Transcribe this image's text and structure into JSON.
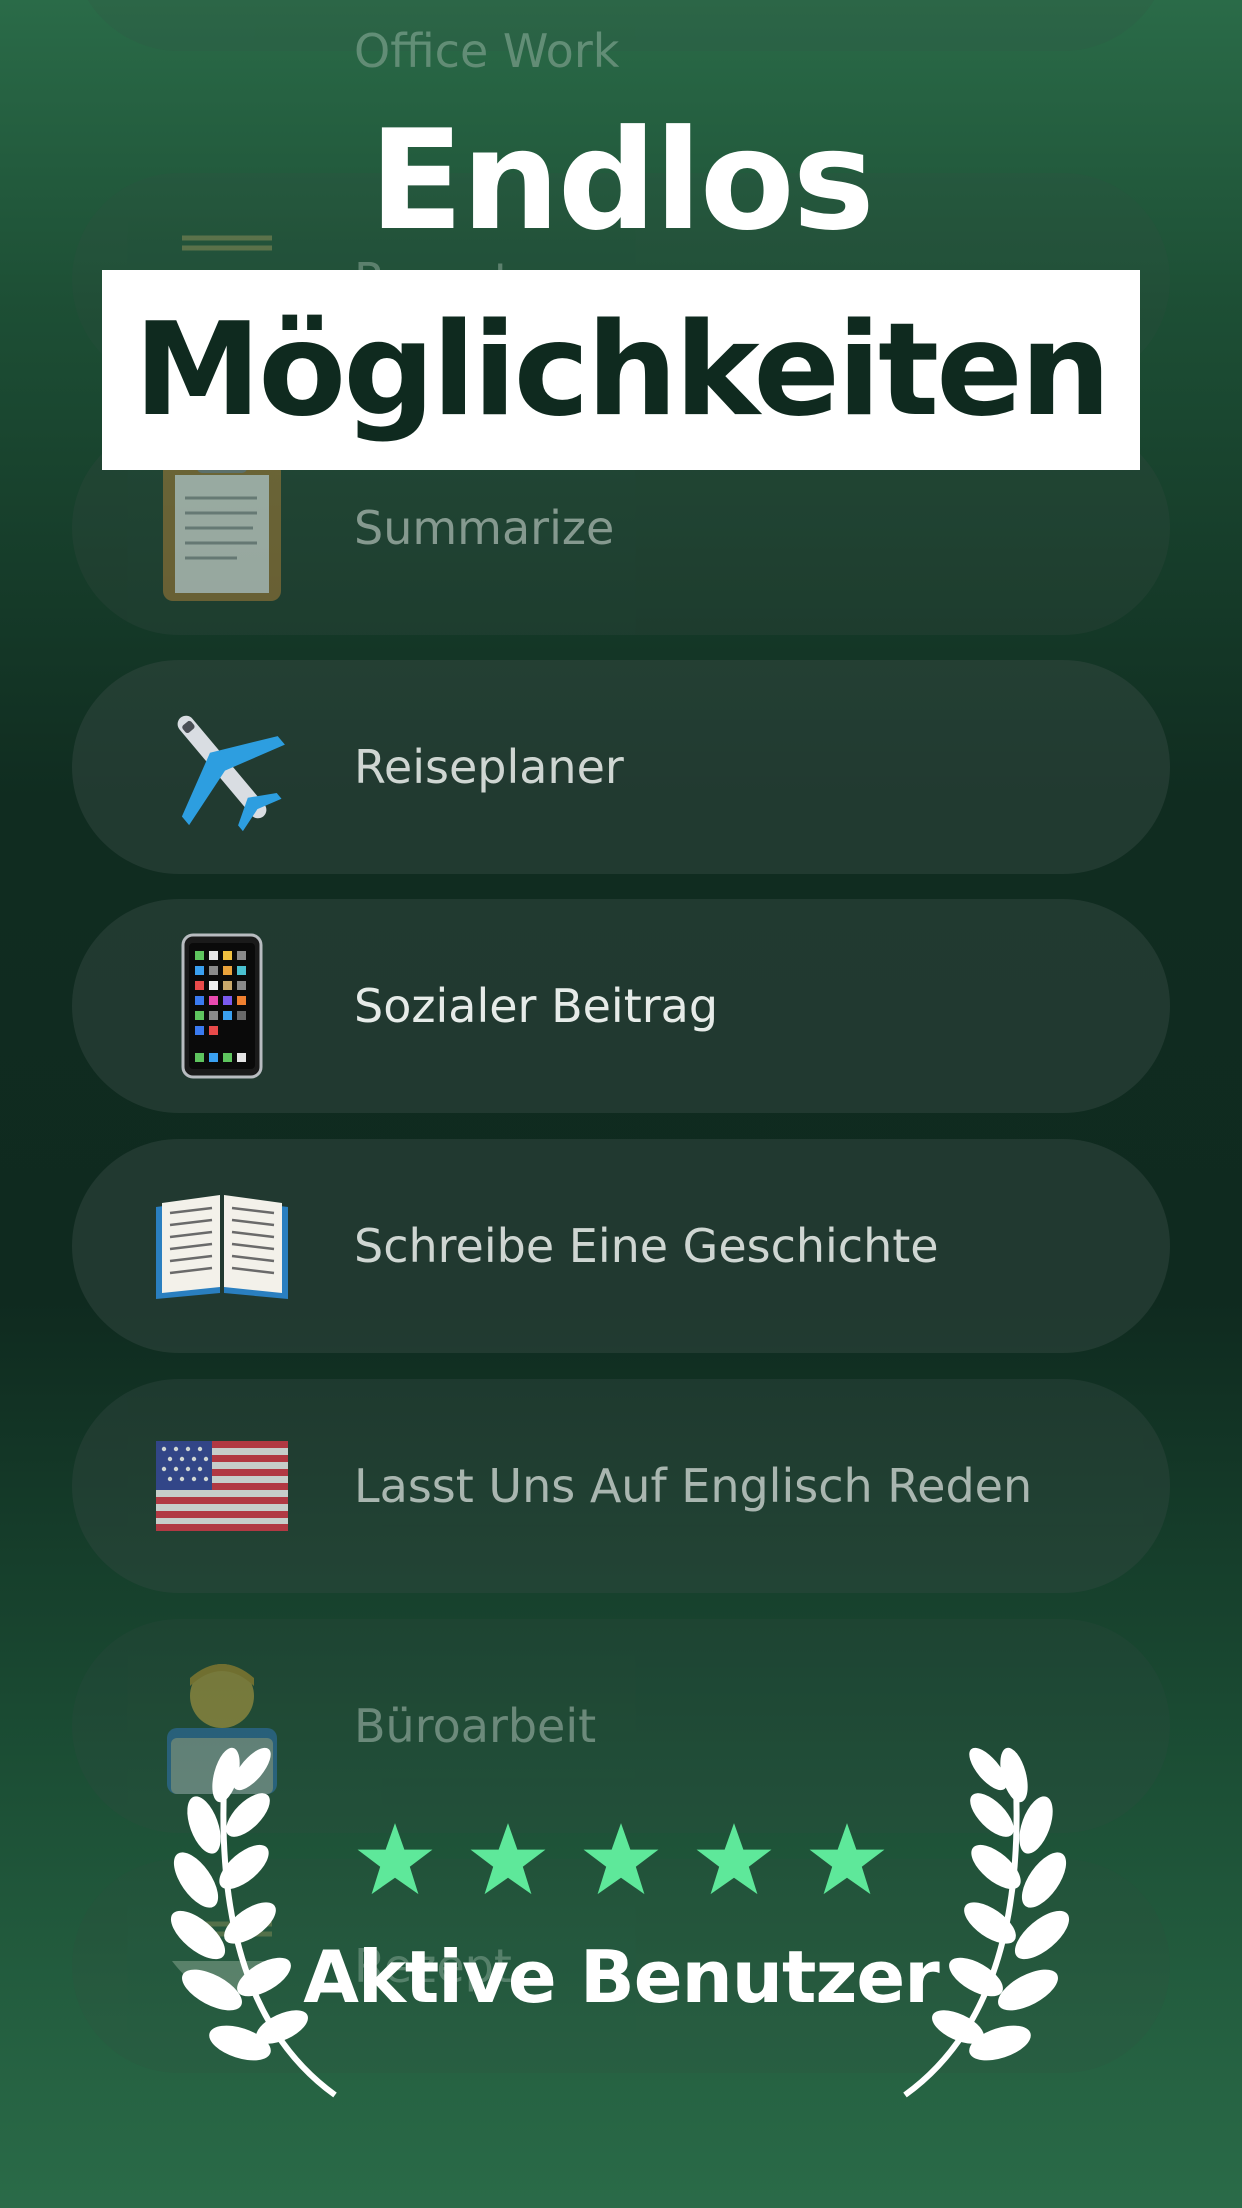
{
  "header": {
    "line1": "Endlos",
    "line2": "Möglichkeiten"
  },
  "items": [
    {
      "label": "Office Work",
      "icon": "laptop-icon"
    },
    {
      "label": "Rezept",
      "icon": "noodle-bowl-icon"
    },
    {
      "label": "Summarize",
      "icon": "clipboard-icon"
    },
    {
      "label": "Reiseplaner",
      "icon": "airplane-icon"
    },
    {
      "label": "Sozialer Beitrag",
      "icon": "smartphone-icon"
    },
    {
      "label": "Schreibe Eine Geschichte",
      "icon": "open-book-icon"
    },
    {
      "label": "Lasst Uns Auf Englisch Reden",
      "icon": "us-flag-icon"
    },
    {
      "label": "Büroarbeit",
      "icon": "office-worker-icon"
    },
    {
      "label": "Rezept",
      "icon": "noodle-bowl-icon"
    }
  ],
  "rating": {
    "stars": 5,
    "star_color": "#5ee89a",
    "label": "Aktive Benutzer"
  }
}
